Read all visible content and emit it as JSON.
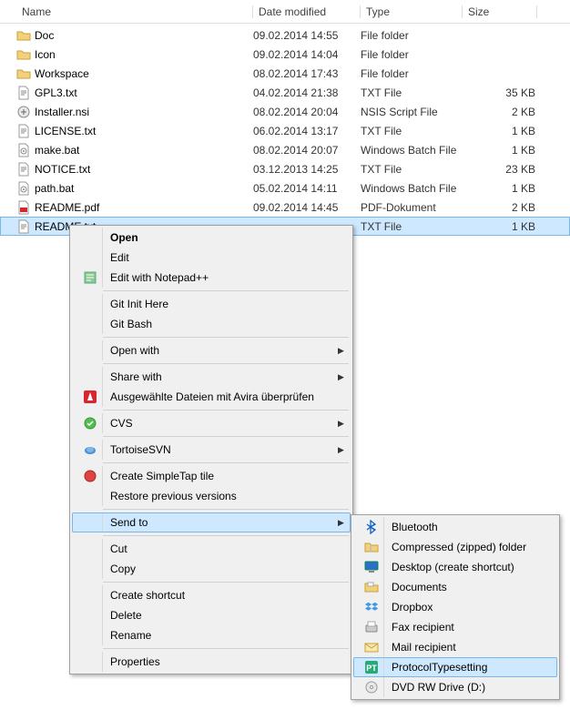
{
  "columns": {
    "name": "Name",
    "date": "Date modified",
    "type": "Type",
    "size": "Size"
  },
  "files": [
    {
      "name": "Doc",
      "date": "09.02.2014 14:55",
      "type": "File folder",
      "size": "",
      "icon": "folder"
    },
    {
      "name": "Icon",
      "date": "09.02.2014 14:04",
      "type": "File folder",
      "size": "",
      "icon": "folder"
    },
    {
      "name": "Workspace",
      "date": "08.02.2014 17:43",
      "type": "File folder",
      "size": "",
      "icon": "folder"
    },
    {
      "name": "GPL3.txt",
      "date": "04.02.2014 21:38",
      "type": "TXT File",
      "size": "35 KB",
      "icon": "txt"
    },
    {
      "name": "Installer.nsi",
      "date": "08.02.2014 20:04",
      "type": "NSIS Script File",
      "size": "2 KB",
      "icon": "nsi"
    },
    {
      "name": "LICENSE.txt",
      "date": "06.02.2014 13:17",
      "type": "TXT File",
      "size": "1 KB",
      "icon": "txt"
    },
    {
      "name": "make.bat",
      "date": "08.02.2014 20:07",
      "type": "Windows Batch File",
      "size": "1 KB",
      "icon": "bat"
    },
    {
      "name": "NOTICE.txt",
      "date": "03.12.2013 14:25",
      "type": "TXT File",
      "size": "23 KB",
      "icon": "txt"
    },
    {
      "name": "path.bat",
      "date": "05.02.2014 14:11",
      "type": "Windows Batch File",
      "size": "1 KB",
      "icon": "bat"
    },
    {
      "name": "README.pdf",
      "date": "09.02.2014 14:45",
      "type": "PDF-Dokument",
      "size": "2 KB",
      "icon": "pdf"
    },
    {
      "name": "README.txt",
      "date": "",
      "type": "TXT File",
      "size": "1 KB",
      "icon": "txt",
      "selected": true
    }
  ],
  "menu": {
    "open": "Open",
    "edit": "Edit",
    "notepadpp": "Edit with Notepad++",
    "git_init": "Git Init Here",
    "git_bash": "Git Bash",
    "open_with": "Open with",
    "share_with": "Share with",
    "avira": "Ausgewählte Dateien mit Avira überprüfen",
    "cvs": "CVS",
    "tortoise": "TortoiseSVN",
    "simpletap": "Create SimpleTap tile",
    "restore": "Restore previous versions",
    "send_to": "Send to",
    "cut": "Cut",
    "copy": "Copy",
    "shortcut": "Create shortcut",
    "delete": "Delete",
    "rename": "Rename",
    "properties": "Properties"
  },
  "submenu": {
    "bluetooth": "Bluetooth",
    "zip": "Compressed (zipped) folder",
    "desktop": "Desktop (create shortcut)",
    "documents": "Documents",
    "dropbox": "Dropbox",
    "fax": "Fax recipient",
    "mail": "Mail recipient",
    "pt": "ProtocolTypesetting",
    "dvd": "DVD RW Drive (D:)"
  }
}
